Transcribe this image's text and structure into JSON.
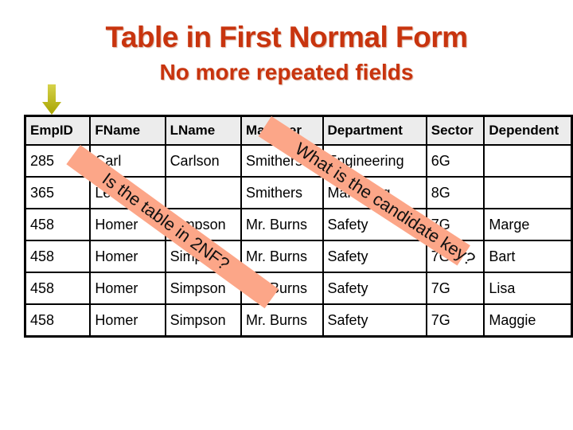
{
  "slide": {
    "title": "Table in First Normal Form",
    "subtitle": "No more repeated fields",
    "colors": {
      "title": "#c8340e",
      "band": "#fca688",
      "arrow": "#b8b400",
      "header_bg": "#ececec"
    },
    "arrow_icon": "down-arrow"
  },
  "table": {
    "headers": [
      "EmpID",
      "FName",
      "LName",
      "Manager",
      "Department",
      "Sector",
      "Dependent"
    ],
    "rows": [
      [
        "285",
        "Carl",
        "Carlson",
        "Smithers",
        "Engineering",
        "6G",
        ""
      ],
      [
        "365",
        "Lenny",
        "",
        "Smithers",
        "Marketing",
        "8G",
        ""
      ],
      [
        "458",
        "Homer",
        "Simpson",
        "Mr. Burns",
        "Safety",
        "7G",
        "Marge"
      ],
      [
        "458",
        "Homer",
        "Simpson",
        "Mr. Burns",
        "Safety",
        "7G",
        "Bart"
      ],
      [
        "458",
        "Homer",
        "Simpson",
        "Mr. Burns",
        "Safety",
        "7G",
        "Lisa"
      ],
      [
        "458",
        "Homer",
        "Simpson",
        "Mr. Burns",
        "Safety",
        "7G",
        "Maggie"
      ]
    ]
  },
  "callouts": {
    "band1": "Is the table in 2NF?",
    "band2": "What is the candidate key?"
  }
}
